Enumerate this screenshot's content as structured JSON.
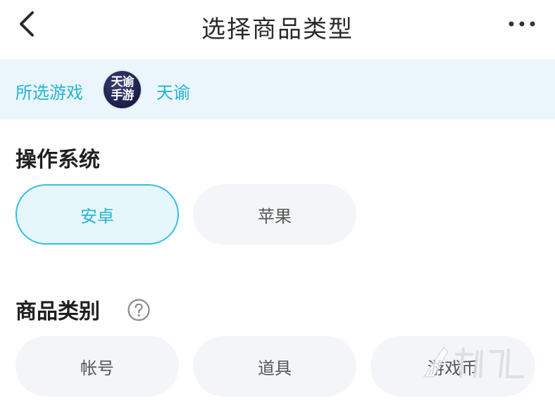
{
  "header": {
    "title": "选择商品类型"
  },
  "game": {
    "label": "所选游戏",
    "logo_line1": "天谕",
    "logo_line2": "手游",
    "name": "天谕"
  },
  "os_section": {
    "title": "操作系统",
    "options": [
      "安卓",
      "苹果"
    ],
    "selected": "安卓"
  },
  "category_section": {
    "title": "商品类别",
    "options": [
      "帐号",
      "道具",
      "游戏币"
    ]
  },
  "colors": {
    "accent": "#27b3d6",
    "accent_border": "#33bfe3",
    "selected_bg": "#e6f7fc",
    "banner_bg": "#eaf6fb",
    "chip_bg": "#f4f5f8"
  },
  "icons": {
    "back": "chevron-left-icon",
    "more": "more-horizontal-icon",
    "help": "question-circle-icon"
  }
}
